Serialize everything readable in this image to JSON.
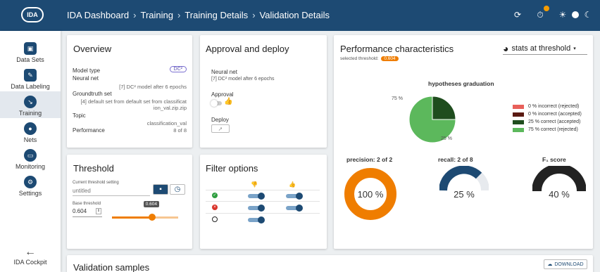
{
  "header": {
    "logo": "IDA",
    "breadcrumbs": [
      "IDA Dashboard",
      "Training",
      "Training Details",
      "Validation Details"
    ]
  },
  "sidebar": {
    "items": [
      {
        "label": "Data Sets",
        "icon": "database-icon"
      },
      {
        "label": "Data Labeling",
        "icon": "label-icon"
      },
      {
        "label": "Training",
        "icon": "training-icon"
      },
      {
        "label": "Nets",
        "icon": "location-icon"
      },
      {
        "label": "Monitoring",
        "icon": "monitor-icon"
      },
      {
        "label": "Settings",
        "icon": "gear-icon"
      }
    ],
    "active": "Training",
    "cockpit_label": "IDA Cockpit"
  },
  "overview": {
    "title": "Overview",
    "model_type_label": "Model type",
    "model_type_badge": "DC²",
    "neural_net_label": "Neural net",
    "neural_net_value": "[7] DC² model after 6 epochs",
    "groundtruth_label": "Groundtruth set",
    "groundtruth_value": "[4] default set from default set from classificat ion_val.zip.zip",
    "topic_label": "Topic",
    "topic_value": "classification_val",
    "performance_label": "Performance",
    "performance_value": "8 of 8"
  },
  "approval": {
    "title": "Approval and deploy",
    "neural_net_label": "Neural net",
    "neural_net_value": "[7] DC² model after 6 epochs",
    "approval_label": "Approval",
    "deploy_label": "Deploy"
  },
  "threshold": {
    "title": "Threshold",
    "current_setting_label": "Current threshold setting",
    "current_setting_placeholder": "untitled",
    "base_label": "Base threshold",
    "base_value": "0.604",
    "slider_tooltip": "0.604",
    "slider_level": 0.604
  },
  "filter": {
    "title": "Filter options",
    "rows": [
      {
        "icon": "check-circle-icon",
        "color": "#2e9e3f",
        "thumb_down": true,
        "thumb_up": true
      },
      {
        "icon": "x-circle-icon",
        "color": "#d9342b",
        "thumb_down": true,
        "thumb_up": true
      },
      {
        "icon": "block-icon",
        "color": "#222222",
        "thumb_down": true,
        "thumb_up": null
      }
    ]
  },
  "performance": {
    "title": "Performance characteristics",
    "selected_threshold_label": "selected threshold:",
    "selected_threshold_value": "0.604",
    "dropdown_label": "stats at threshold",
    "pie_title": "hypotheses graduation",
    "pie_label_75": "75 %",
    "pie_label_25": "25 %",
    "legend": [
      {
        "label": "0 % incorrect (rejected)",
        "color": "#e8605a"
      },
      {
        "label": "0 % incorrect (accepted)",
        "color": "#5a1a12"
      },
      {
        "label": "25 % correct (accepted)",
        "color": "#1f4d1e"
      },
      {
        "label": "75 % correct (rejected)",
        "color": "#5cb85c"
      }
    ],
    "precision_title": "precision: 2 of 2",
    "precision_value": "100 %",
    "recall_title": "recall: 2 of 8",
    "recall_value": "25 %",
    "f1_title": "F₁ score",
    "f1_value": "40 %",
    "gauge_colors": {
      "precision": "#ef7d00",
      "recall": "#1d4a73",
      "f1": "#222222"
    }
  },
  "chart_data": {
    "type": "pie",
    "title": "hypotheses graduation",
    "categories": [
      "incorrect (rejected)",
      "incorrect (accepted)",
      "correct (accepted)",
      "correct (rejected)"
    ],
    "values": [
      0,
      0,
      25,
      75
    ]
  },
  "validation": {
    "title": "Validation samples",
    "download_label": "DOWNLOAD"
  }
}
